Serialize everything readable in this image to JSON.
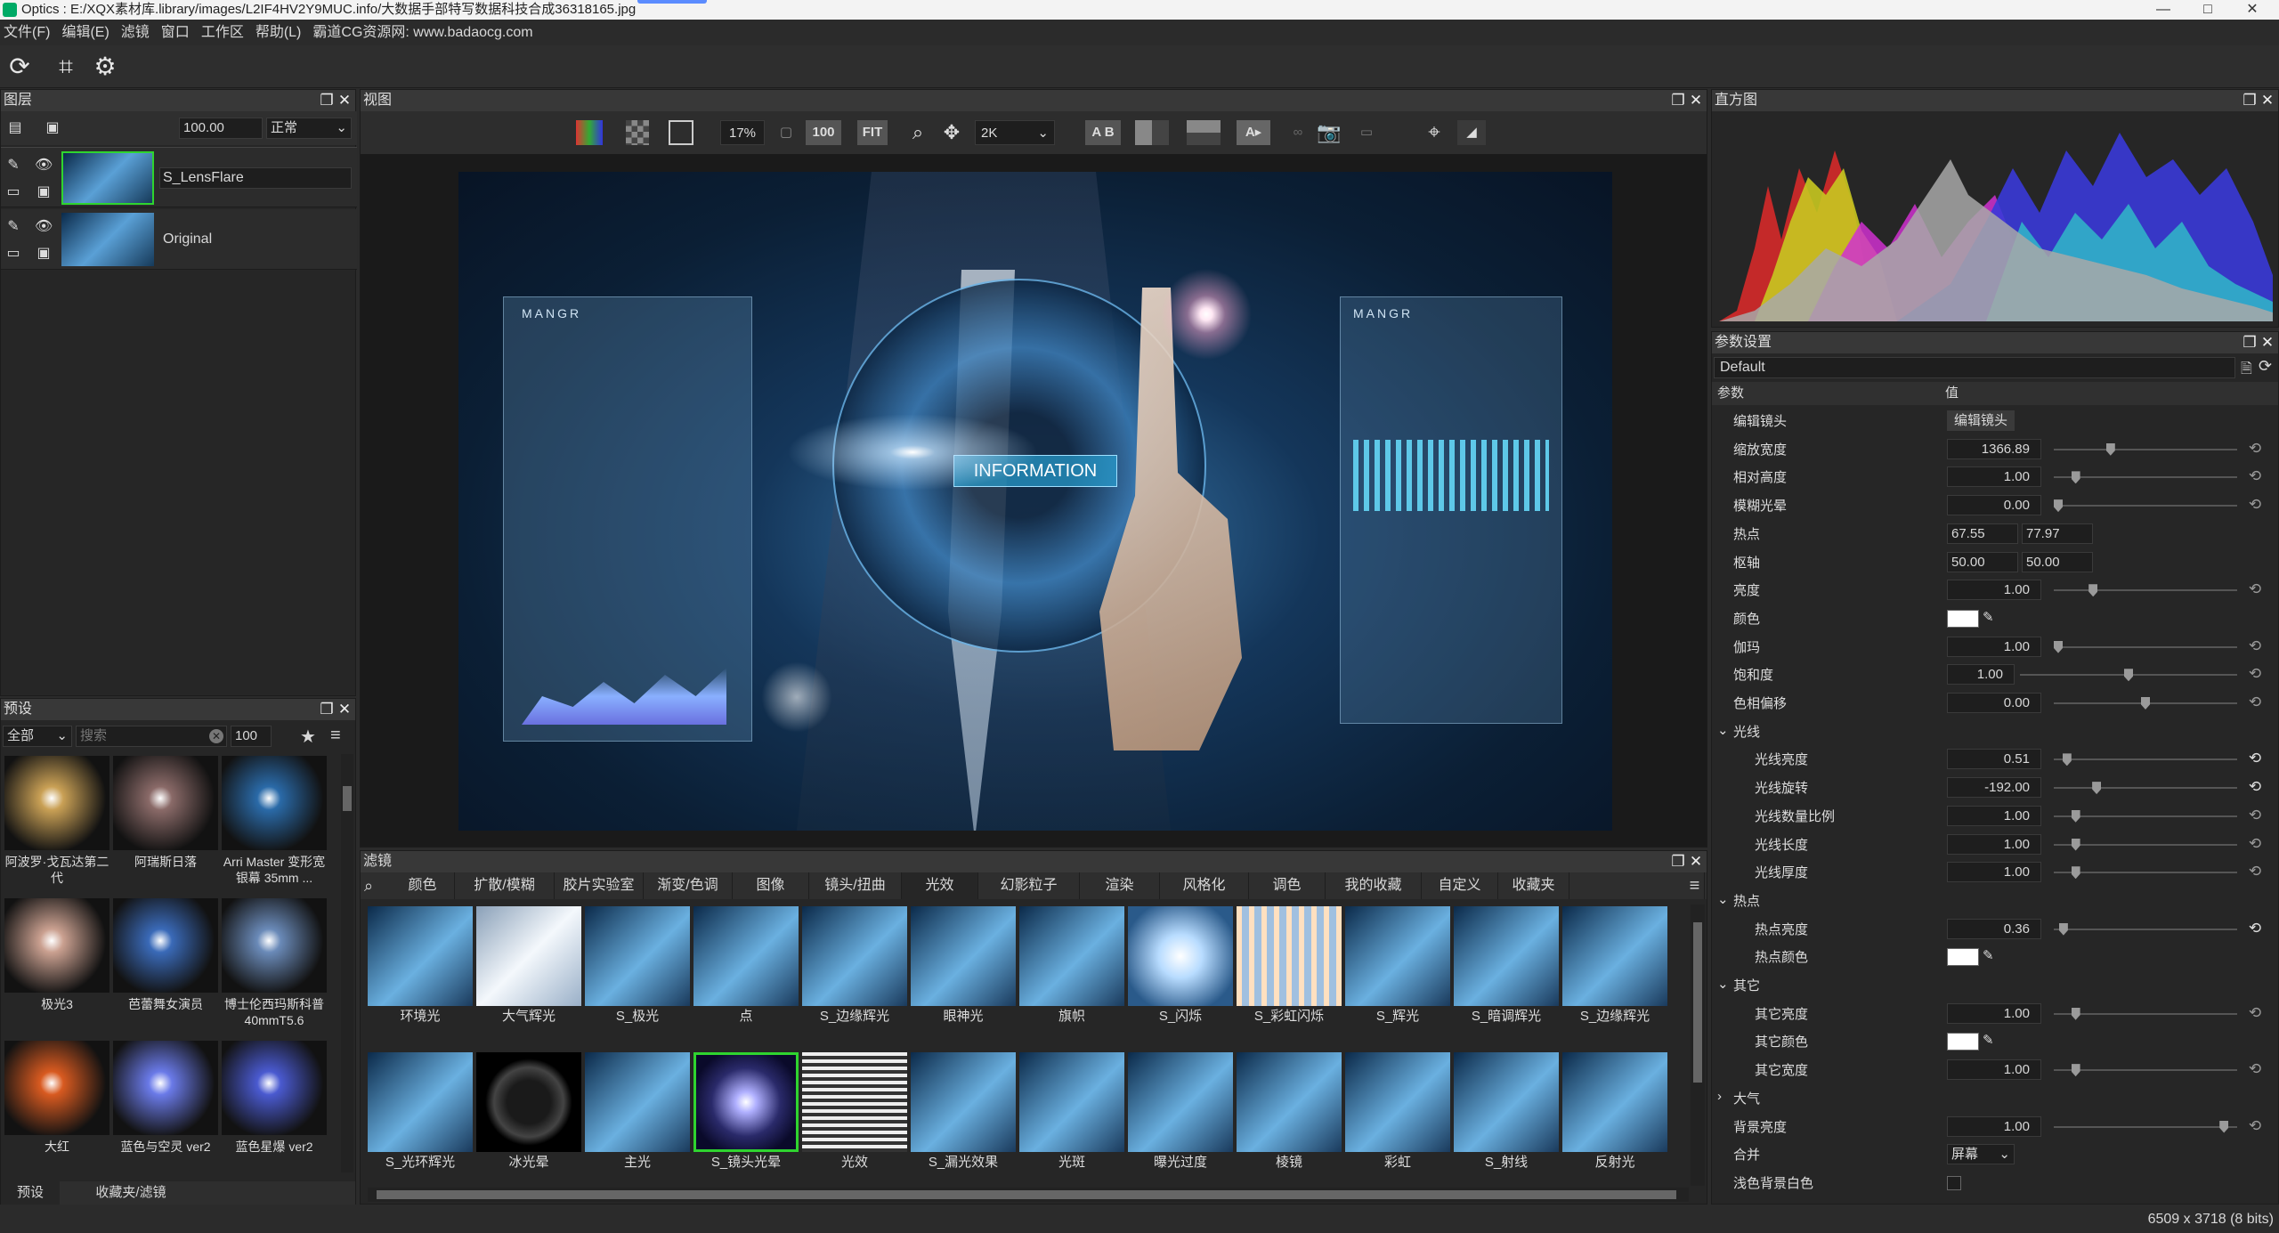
{
  "window": {
    "title": "Optics : E:/XQX素材库.library/images/L2IF4HV2Y9MUC.info/大数据手部特写数据科技合成36318165.jpg",
    "min": "—",
    "max": "□",
    "close": "✕"
  },
  "menu": [
    "文件(F)",
    "编辑(E)",
    "滤镜",
    "窗口",
    "工作区",
    "帮助(L)",
    "霸道CG资源网: www.badaocg.com"
  ],
  "layers": {
    "title": "图层",
    "opacity": "100.00",
    "blend": "正常",
    "items": [
      {
        "name": "S_LensFlare"
      },
      {
        "name": "Original"
      }
    ]
  },
  "presets": {
    "title": "预设",
    "category": "全部",
    "search_placeholder": "搜索",
    "size": "100",
    "items": [
      {
        "label": "阿波罗·戈瓦达第二代",
        "color": "#c9a055"
      },
      {
        "label": "阿瑞斯日落",
        "color": "#8a6a68"
      },
      {
        "label": "Arri Master 变形宽银幕 35mm ...",
        "color": "#2a6aa8"
      },
      {
        "label": "极光3",
        "color": "#caa090"
      },
      {
        "label": "芭蕾舞女演员",
        "color": "#3a6ab8"
      },
      {
        "label": "博士伦西玛斯科普40mmT5.6",
        "color": "#6a8ab8"
      },
      {
        "label": "大红",
        "color": "#d85a20"
      },
      {
        "label": "蓝色与空灵 ver2",
        "color": "#6a7ae8"
      },
      {
        "label": "蓝色星爆 ver2",
        "color": "#4a5ad0"
      }
    ],
    "tabs": [
      "预设",
      "收藏夹/滤镜"
    ]
  },
  "view": {
    "title": "视图",
    "zoom": "17%",
    "btn100": "100",
    "fit": "FIT",
    "res": "2K",
    "ab": "A B",
    "photo_text": {
      "info": "INFORMATION",
      "mangr_left": "MANGR",
      "mangr_right": "MANGR"
    }
  },
  "filters": {
    "title": "滤镜",
    "tabs": [
      "颜色",
      "扩散/模糊",
      "胶片实验室",
      "渐变/色调",
      "图像",
      "镜头/扭曲",
      "光效",
      "幻影粒子",
      "渲染",
      "风格化",
      "调色",
      "我的收藏",
      "自定义",
      "收藏夹"
    ],
    "row1": [
      "环境光",
      "大气辉光",
      "S_极光",
      "点",
      "S_边缘辉光",
      "眼神光",
      "旗帜",
      "S_闪烁",
      "S_彩虹闪烁",
      "S_辉光",
      "S_暗调辉光",
      "S_边缘辉光"
    ],
    "row2": [
      "S_光环辉光",
      "冰光晕",
      "主光",
      "S_镜头光晕",
      "光效",
      "S_漏光效果",
      "光斑",
      "曝光过度",
      "棱镜",
      "彩虹",
      "S_射线",
      "反射光"
    ]
  },
  "histogram": {
    "title": "直方图"
  },
  "params": {
    "title": "参数设置",
    "preset": "Default",
    "col_param": "参数",
    "col_value": "值",
    "rows": [
      {
        "label": "编辑镜头",
        "type": "button",
        "value": "编辑镜头"
      },
      {
        "label": "缩放宽度",
        "value": "1366.89",
        "knob": 0.3
      },
      {
        "label": "相对高度",
        "value": "1.00",
        "knob": 0.1
      },
      {
        "label": "模糊光晕",
        "value": "0.00",
        "knob": 0.0
      },
      {
        "label": "热点",
        "type": "pair",
        "value": "67.55",
        "value2": "77.97"
      },
      {
        "label": "枢轴",
        "type": "pair",
        "value": "50.00",
        "value2": "50.00"
      },
      {
        "label": "亮度",
        "value": "1.00",
        "knob": 0.2
      },
      {
        "label": "颜色",
        "type": "color"
      },
      {
        "label": "伽玛",
        "value": "1.00",
        "knob": 0.0
      },
      {
        "label": "饱和度",
        "value": "1.00",
        "knob": 0.5,
        "short": true
      },
      {
        "label": "色相偏移",
        "value": "0.00",
        "knob": 0.5
      },
      {
        "label": "光线",
        "type": "section",
        "open": true
      },
      {
        "label": "光线亮度",
        "value": "0.51",
        "knob": 0.05,
        "indent": true,
        "reset": true
      },
      {
        "label": "光线旋转",
        "value": "-192.00",
        "knob": 0.22,
        "indent": true,
        "reset": true
      },
      {
        "label": "光线数量比例",
        "value": "1.00",
        "knob": 0.1,
        "indent": true
      },
      {
        "label": "光线长度",
        "value": "1.00",
        "knob": 0.1,
        "indent": true
      },
      {
        "label": "光线厚度",
        "value": "1.00",
        "knob": 0.1,
        "indent": true
      },
      {
        "label": "热点",
        "type": "section",
        "open": true
      },
      {
        "label": "热点亮度",
        "value": "0.36",
        "knob": 0.03,
        "indent": true,
        "reset": true
      },
      {
        "label": "热点颜色",
        "type": "color",
        "indent": true
      },
      {
        "label": "其它",
        "type": "section",
        "open": true
      },
      {
        "label": "其它亮度",
        "value": "1.00",
        "knob": 0.1,
        "indent": true
      },
      {
        "label": "其它颜色",
        "type": "color",
        "indent": true
      },
      {
        "label": "其它宽度",
        "value": "1.00",
        "knob": 0.1,
        "indent": true
      },
      {
        "label": "大气",
        "type": "section",
        "open": false
      },
      {
        "label": "背景亮度",
        "value": "1.00",
        "knob": 0.95
      },
      {
        "label": "合并",
        "type": "select",
        "value": "屏幕"
      },
      {
        "label": "浅色背景白色",
        "type": "check"
      }
    ]
  },
  "status": {
    "dims": "6509 x 3718 (8 bits)"
  }
}
